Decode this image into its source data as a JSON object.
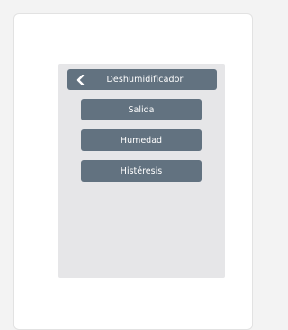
{
  "header": {
    "title": "Deshumidificador",
    "back_icon": "chevron-left-icon"
  },
  "menu": {
    "items": [
      {
        "label": "Salida"
      },
      {
        "label": "Humedad"
      },
      {
        "label": "Histéresis"
      }
    ]
  },
  "colors": {
    "button_bg": "#627280",
    "screen_bg": "#e6e6e8",
    "card_bg": "#ffffff",
    "page_bg": "#f3f3f3",
    "text": "#ffffff"
  }
}
